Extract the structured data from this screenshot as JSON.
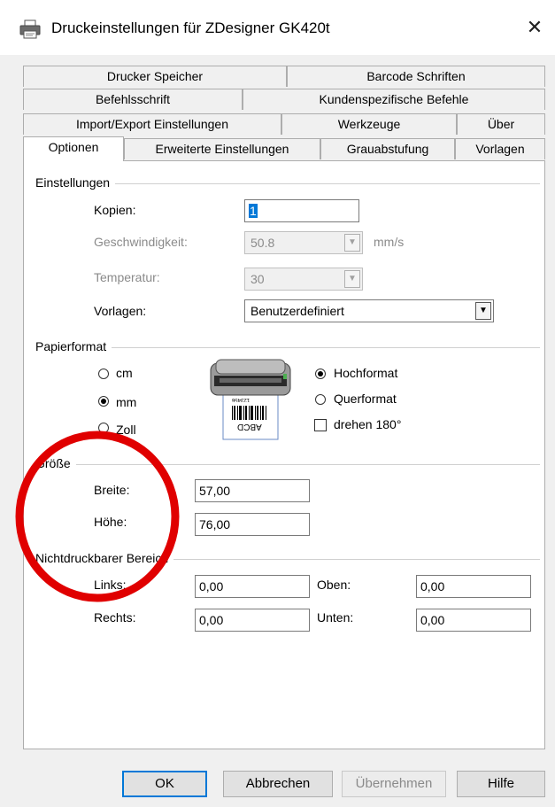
{
  "window": {
    "title": "Druckeinstellungen für ZDesigner GK420t",
    "close_glyph": "✕"
  },
  "tabs": {
    "row1": [
      "Drucker Speicher",
      "Barcode Schriften"
    ],
    "row2": [
      "Befehlsschrift",
      "Kundenspezifische Befehle"
    ],
    "row3": [
      "Import/Export Einstellungen",
      "Werkzeuge",
      "Über"
    ],
    "row4": [
      "Optionen",
      "Erweiterte Einstellungen",
      "Grauabstufung",
      "Vorlagen"
    ],
    "selected": "Optionen"
  },
  "einstellungen": {
    "group_label": "Einstellungen",
    "kopien_label": "Kopien:",
    "kopien_value": "1",
    "geschwindigkeit_label": "Geschwindigkeit:",
    "geschwindigkeit_value": "50.8",
    "geschwindigkeit_unit": "mm/s",
    "temperatur_label": "Temperatur:",
    "temperatur_value": "30",
    "vorlagen_label": "Vorlagen:",
    "vorlagen_value": "Benutzerdefiniert"
  },
  "papierformat": {
    "group_label": "Papierformat",
    "unit_cm": "cm",
    "unit_mm": "mm",
    "unit_zoll": "Zoll",
    "selected_unit": "mm",
    "hochformat": "Hochformat",
    "querformat": "Querformat",
    "selected_orientation": "Hochformat",
    "drehen_label": "drehen 180°",
    "drehen_checked": false,
    "preview_label_text": "ABCD",
    "preview_code_text": "123456"
  },
  "groesse": {
    "group_label": "Größe",
    "breite_label": "Breite:",
    "breite_value": "57,00",
    "hoehe_label": "Höhe:",
    "hoehe_value": "76,00"
  },
  "nichtdruckbar": {
    "group_label": "Nichtdruckbarer Bereich",
    "links_label": "Links:",
    "links_value": "0,00",
    "oben_label": "Oben:",
    "oben_value": "0,00",
    "rechts_label": "Rechts:",
    "rechts_value": "0,00",
    "unten_label": "Unten:",
    "unten_value": "0,00"
  },
  "buttons": {
    "ok": "OK",
    "abbrechen": "Abbrechen",
    "uebernehmen": "Übernehmen",
    "hilfe": "Hilfe"
  },
  "colors": {
    "annotation_circle": "#e00000",
    "selection": "#0078d7"
  }
}
